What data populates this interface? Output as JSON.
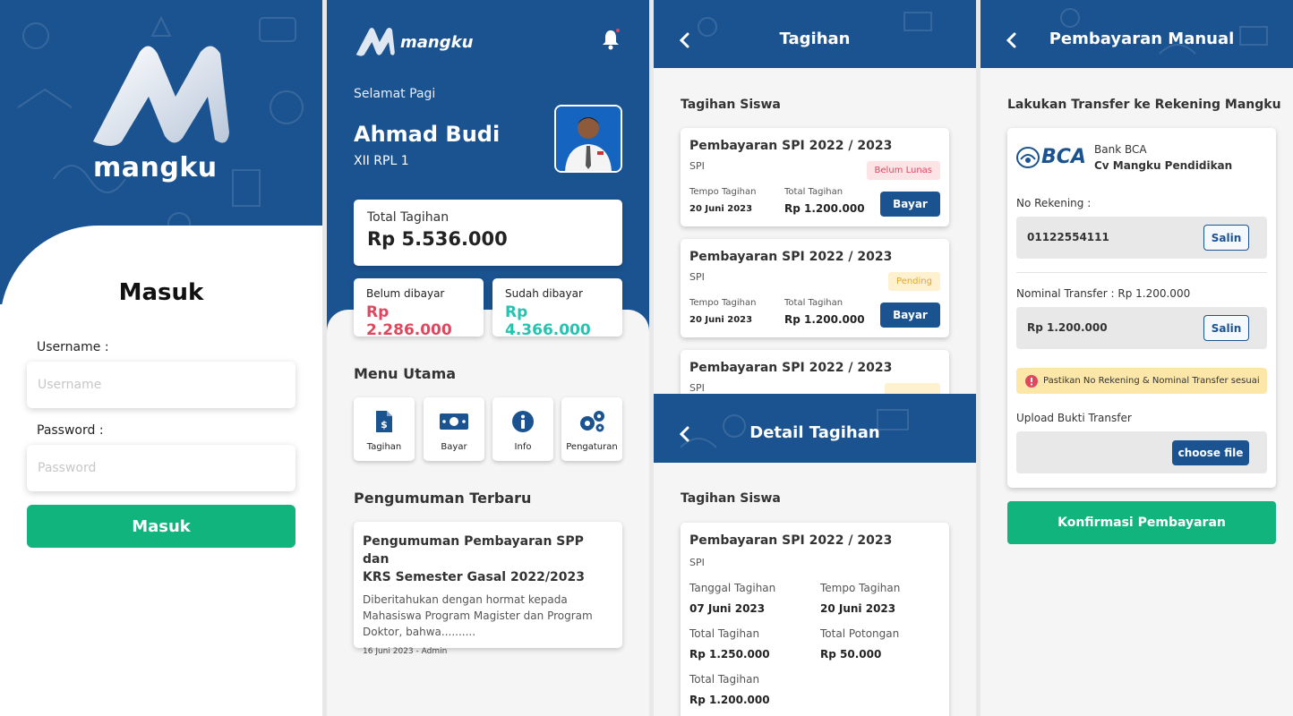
{
  "colors": {
    "primary": "#1b5390",
    "success": "#12b47e",
    "danger": "#e0475f",
    "info": "#25c3b0",
    "warning": "#fce7a8"
  },
  "login": {
    "brand": "mangku",
    "title": "Masuk",
    "username_label": "Username :",
    "username_placeholder": "Username",
    "password_label": "Password :",
    "password_placeholder": "Password",
    "submit_label": "Masuk"
  },
  "dashboard": {
    "brand": "mangku",
    "greeting": "Selamat Pagi",
    "user_name": "Ahmad Budi",
    "user_class": "XII RPL 1",
    "total_label": "Total Tagihan",
    "total_value": "Rp 5.536.000",
    "unpaid_label": "Belum dibayar",
    "unpaid_value": "Rp 2.286.000",
    "paid_label": "Sudah dibayar",
    "paid_value": "Rp 4.366.000",
    "menu_title": "Menu Utama",
    "menu": [
      {
        "label": "Tagihan",
        "icon": "invoice-icon"
      },
      {
        "label": "Bayar",
        "icon": "money-icon"
      },
      {
        "label": "Info",
        "icon": "info-icon"
      },
      {
        "label": "Pengaturan",
        "icon": "gears-icon"
      }
    ],
    "announce_title": "Pengumuman Terbaru",
    "announcement": {
      "title_line1": "Pengumuman Pembayaran SPP dan",
      "title_line2": "KRS Semester Gasal 2022/2023",
      "desc_line1": "Diberitahukan dengan hormat kepada",
      "desc_line2": "Mahasiswa Program Magister dan Program",
      "desc_line3": "Doktor, bahwa..........",
      "meta": "16 Juni 2023 - Admin"
    }
  },
  "tagihan": {
    "title": "Tagihan",
    "section": "Tagihan Siswa",
    "bills": [
      {
        "title": "Pembayaran SPI 2022 / 2023",
        "type": "SPI",
        "status": "Belum Lunas",
        "tempo_label": "Tempo Tagihan",
        "tempo": "20 Juni 2023",
        "total_label": "Total Tagihan",
        "total": "Rp 1.200.000",
        "pay_label": "Bayar"
      },
      {
        "title": "Pembayaran SPI 2022 / 2023",
        "type": "SPI",
        "status": "Pending",
        "tempo_label": "Tempo Tagihan",
        "tempo": "20 Juni 2023",
        "total_label": "Total Tagihan",
        "total": "Rp 1.200.000",
        "pay_label": "Bayar"
      },
      {
        "title": "Pembayaran SPI 2022 / 2023",
        "type": "SPI"
      }
    ]
  },
  "detail": {
    "title": "Detail Tagihan",
    "section": "Tagihan Siswa",
    "bill_title": "Pembayaran SPI 2022 / 2023",
    "type": "SPI",
    "tanggal_label": "Tanggal Tagihan",
    "tanggal": "07 Juni 2023",
    "tempo_label": "Tempo Tagihan",
    "tempo": "20 Juni 2023",
    "total_label": "Total Tagihan",
    "total": "Rp 1.250.000",
    "potongan_label": "Total Potongan",
    "potongan": "Rp 50.000",
    "total2_label": "Total Tagihan",
    "total2": "Rp 1.200.000"
  },
  "manual": {
    "title": "Pembayaran Manual",
    "instruction": "Lakukan Transfer ke Rekening  Mangku",
    "bank_logo_text": "BCA",
    "bank_name": "Bank BCA",
    "bank_owner": "Cv Mangku Pendidikan",
    "account_label": "No Rekening :",
    "account_number": "01122554111",
    "copy_label": "Salin",
    "nominal_label": "Nominal Transfer : Rp 1.200.000",
    "nominal_value": "Rp 1.200.000",
    "warning": "Pastikan No Rekening & Nominal Transfer sesuai",
    "upload_label": "Upload Bukti Transfer",
    "choose_label": "choose file",
    "confirm_label": "Konfirmasi Pembayaran"
  }
}
